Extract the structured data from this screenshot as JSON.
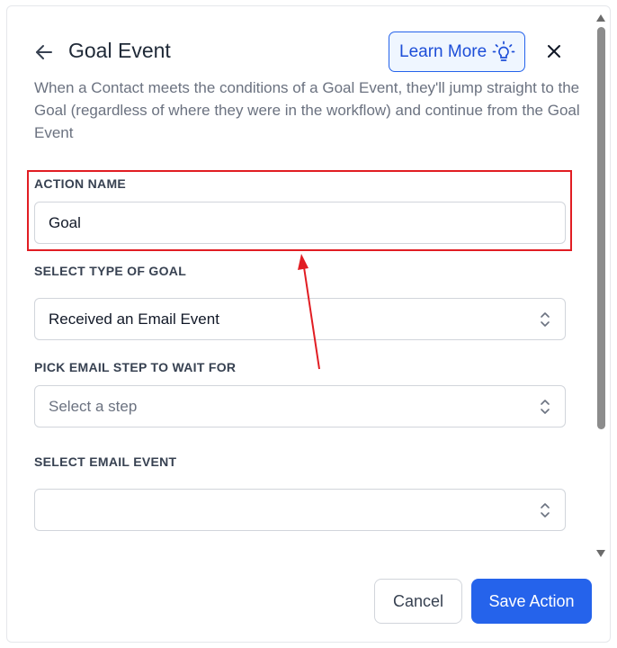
{
  "header": {
    "title": "Goal Event",
    "learn_more_label": "Learn More",
    "description": "When a Contact meets the conditions of a Goal Event, they'll jump straight to the Goal (regardless of where they were in the workflow) and continue from the Goal Event"
  },
  "form": {
    "action_name": {
      "label": "ACTION NAME",
      "value": "Goal"
    },
    "goal_type": {
      "label": "SELECT TYPE OF GOAL",
      "value": "Received an Email Event"
    },
    "email_step": {
      "label": "PICK EMAIL STEP TO WAIT FOR",
      "placeholder": "Select a step"
    },
    "email_event": {
      "label": "SELECT EMAIL EVENT",
      "value": ""
    }
  },
  "footer": {
    "cancel_label": "Cancel",
    "save_label": "Save Action"
  },
  "colors": {
    "primary": "#2563eb",
    "annotation": "#e11d23",
    "learn_more_bg": "#eff6ff"
  },
  "icons": [
    "back-arrow-icon",
    "lightbulb-icon",
    "close-icon",
    "select-arrows-icon",
    "scroll-up-icon",
    "scroll-down-icon"
  ]
}
